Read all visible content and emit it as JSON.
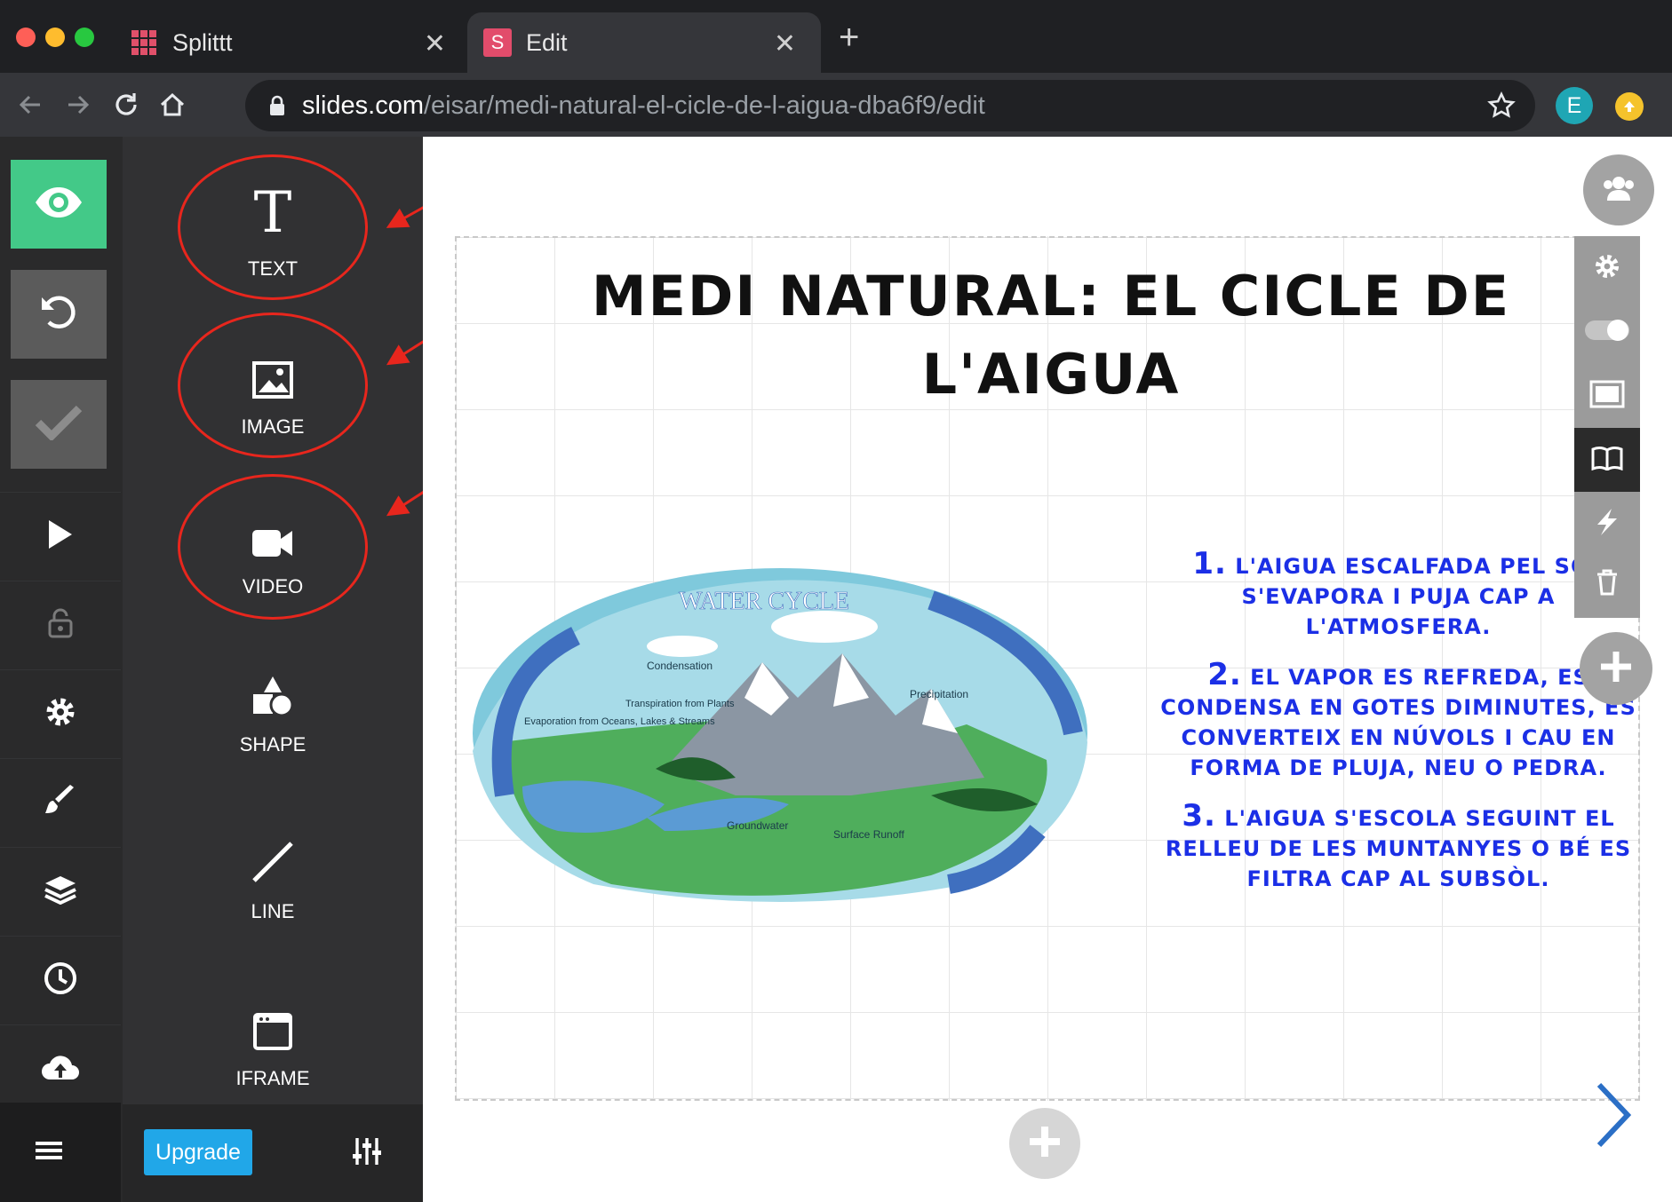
{
  "browser": {
    "tabs": [
      {
        "title": "Splittt",
        "favicon": "grid-favicon-icon"
      },
      {
        "title": "Edit",
        "favicon": "S",
        "active": true
      }
    ],
    "new_tab_label": "+",
    "url_domain": "slides.com",
    "url_path": "/eisar/medi-natural-el-cicle-de-l-aigua-dba6f9/edit",
    "profile_initial": "E",
    "colors": {
      "profile": "#1fa6b4",
      "extension": "#f5c32c"
    }
  },
  "sidebar": {
    "icons": [
      "eye-icon",
      "undo-icon",
      "check-icon",
      "play-icon",
      "lock-icon",
      "gear-icon",
      "brush-icon",
      "layers-icon",
      "clock-icon",
      "cloud-upload-icon",
      "menu-icon"
    ],
    "colors": {
      "preview": "#43c988",
      "inactive": "#5b5b5b"
    }
  },
  "panel": {
    "items": [
      {
        "label": "TEXT",
        "icon": "text-icon",
        "highlighted": true
      },
      {
        "label": "IMAGE",
        "icon": "image-icon",
        "highlighted": true
      },
      {
        "label": "VIDEO",
        "icon": "video-camera-icon",
        "highlighted": true
      },
      {
        "label": "SHAPE",
        "icon": "shapes-icon"
      },
      {
        "label": "LINE",
        "icon": "line-icon"
      },
      {
        "label": "IFRAME",
        "icon": "iframe-icon"
      }
    ],
    "upgrade_label": "Upgrade",
    "colors": {
      "upgrade": "#21a7e8",
      "highlight": "#e8261d"
    }
  },
  "slide": {
    "title": "MEDI NATURAL: EL CICLE DE L'AIGUA",
    "steps": [
      {
        "num": "1.",
        "text": "L'AIGUA ESCALFADA PEL SOL S'EVAPORA I PUJA CAP A L'ATMOSFERA."
      },
      {
        "num": "2.",
        "text": "EL VAPOR ES REFREDA, ES CONDENSA EN GOTES DIMINUTES, ES CONVERTEIX EN NÚVOLS I CAU EN FORMA DE PLUJA, NEU O PEDRA."
      },
      {
        "num": "3.",
        "text": "L'AIGUA S'ESCOLA SEGUINT EL RELLEU DE LES MUNTANYES O BÉ ES FILTRA CAP AL SUBSÒL."
      }
    ],
    "diagram": {
      "title": "WATER CYCLE",
      "labels": [
        "Condensation",
        "Transpiration from Plants",
        "Evaporation from Oceans, Lakes & Streams",
        "Precipitation",
        "Groundwater",
        "Surface Runoff"
      ]
    },
    "colors": {
      "steps_text": "#1b2fe6",
      "title": "#111111"
    }
  },
  "right_tools": [
    "collaborators-icon",
    "gear-icon",
    "toggle-icon",
    "frame-icon",
    "book-icon",
    "lightning-icon",
    "trash-icon",
    "add-slide-right-icon"
  ],
  "bottom": {
    "add_slide_icon": "add-slide-down-icon",
    "next_icon": "chevron-right-icon"
  }
}
